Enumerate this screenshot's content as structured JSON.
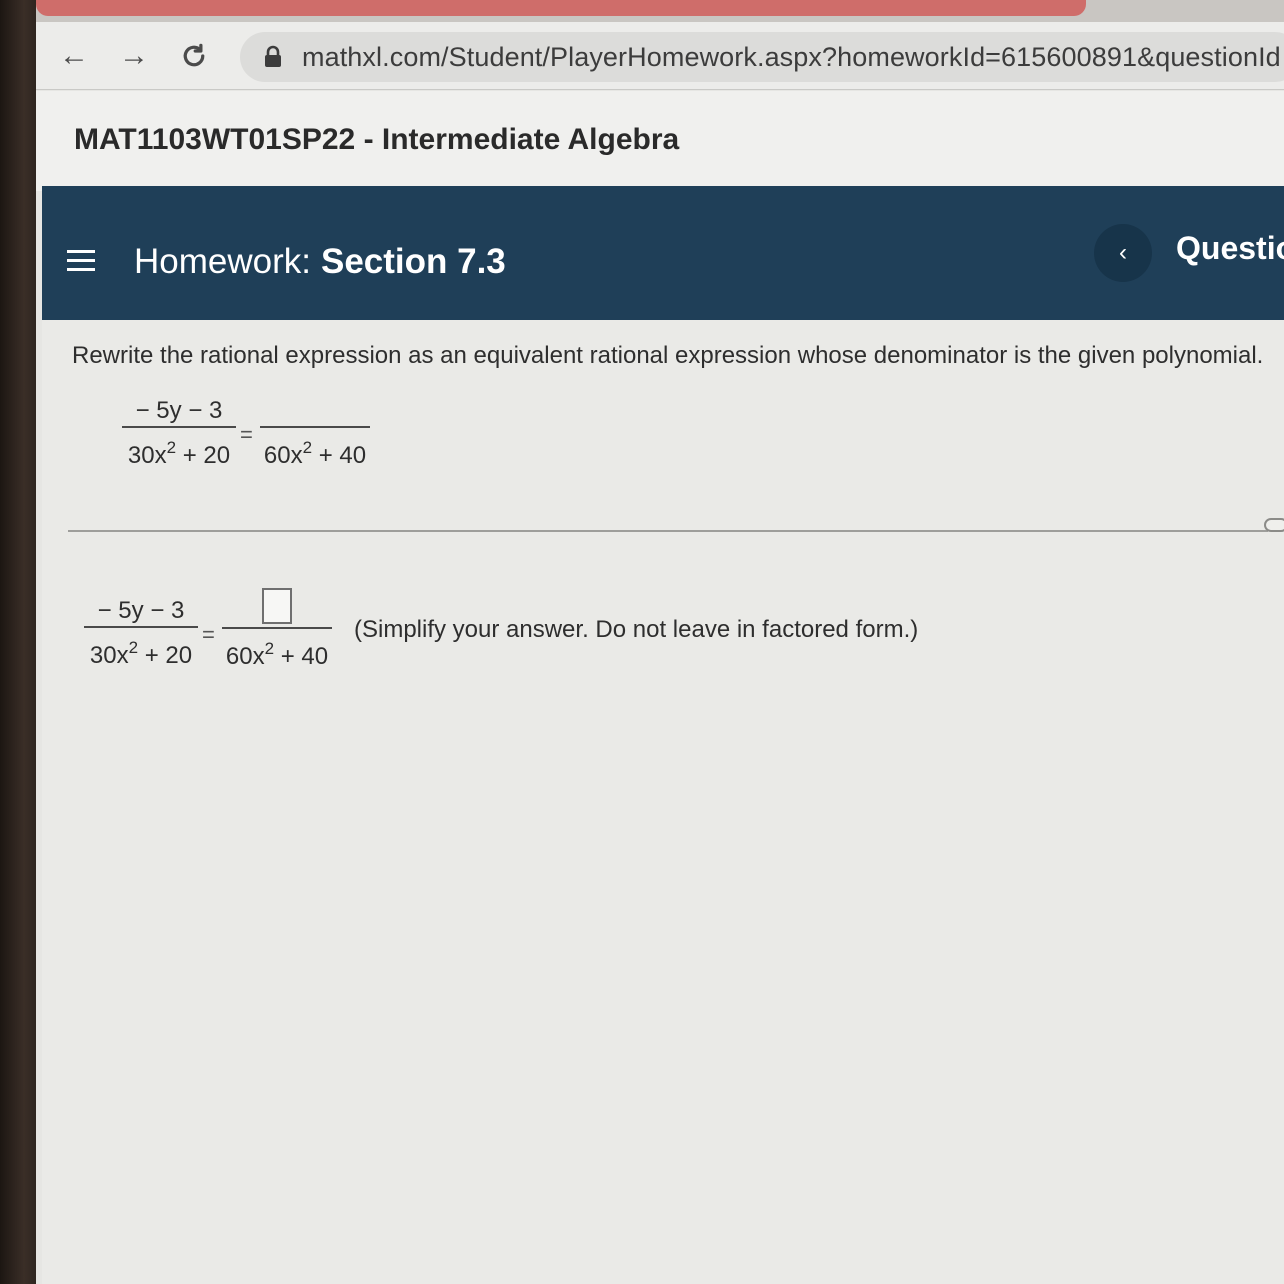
{
  "browser": {
    "url": "mathxl.com/Student/PlayerHomework.aspx?homeworkId=615600891&questionId",
    "back_glyph": "←",
    "forward_glyph": "→"
  },
  "course": {
    "title": "MAT1103WT01SP22 - Intermediate Algebra"
  },
  "homework": {
    "label": "Homework:",
    "section": "Section 7.3",
    "prev_glyph": "‹",
    "question_label": "Questio"
  },
  "problem": {
    "instruction": "Rewrite the rational expression as an equivalent rational expression whose denominator is the given polynomial.",
    "given": {
      "numerator": "− 5y − 3",
      "denominator_base": "30x",
      "denominator_exp": "2",
      "denominator_rest": " + 20",
      "equals": "=",
      "target_numerator": "",
      "target_denominator_base": "60x",
      "target_denominator_exp": "2",
      "target_denominator_rest": " + 40"
    },
    "answer": {
      "numerator": "− 5y − 3",
      "denominator_base": "30x",
      "denominator_exp": "2",
      "denominator_rest": " + 20",
      "equals": "=",
      "answer_value": "",
      "target_denominator_base": "60x",
      "target_denominator_exp": "2",
      "target_denominator_rest": " + 40",
      "hint": "(Simplify your answer.  Do not leave in factored form.)"
    }
  },
  "colors": {
    "banner": "#1f3f58",
    "tab_active": "#cf6d6a"
  }
}
